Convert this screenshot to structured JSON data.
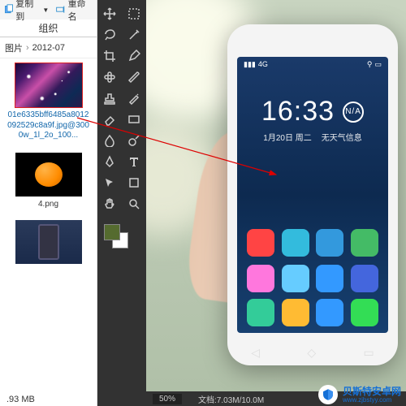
{
  "ribbon": {
    "copy": "复制到",
    "rename": "重命名"
  },
  "organize": "组织",
  "breadcrumb": {
    "parent": "图片",
    "folder": "2012-07"
  },
  "files": {
    "galaxy_name": "01e6335bff6485a8012092529c8a9f.jpg@3000w_1l_2o_100...",
    "orange_name": "4.png",
    "size_line": ".93 MB"
  },
  "ps_footer": {
    "zoom": "50%",
    "doc": "文档:7.03M/10.0M"
  },
  "phone": {
    "time": "16:33",
    "weather_badge": "N/A",
    "date": "1月20日 周二",
    "weather_text": "无天气信息",
    "status_signal": "▮▮▮",
    "status_net": "4G",
    "apps": {
      "row1": [
        "#f44",
        "#3bd",
        "#39d",
        "#4b6"
      ],
      "row2": [
        "#f7d",
        "#6cf",
        "#39f",
        "#46d"
      ],
      "dock": [
        "#3c9",
        "#fb3",
        "#39f",
        "#3d5"
      ]
    }
  },
  "watermark": {
    "name": "贝斯特安卓网",
    "url": "www.zjbstyy.com"
  }
}
